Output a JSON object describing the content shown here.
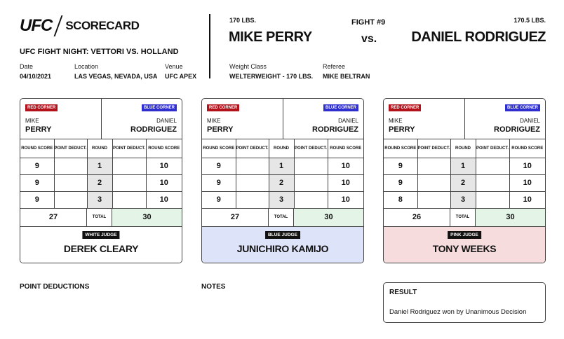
{
  "header": {
    "brand": "UFC",
    "doc_title": "SCORECARD",
    "event": "UFC FIGHT NIGHT: VETTORI VS. HOLLAND",
    "date_label": "Date",
    "date": "04/10/2021",
    "location_label": "Location",
    "location": "LAS VEGAS, NEVADA, USA",
    "venue_label": "Venue",
    "venue": "UFC APEX",
    "weight_class_label": "Weight Class",
    "weight_class": "WELTERWEIGHT - 170 LBS.",
    "referee_label": "Referee",
    "referee": "MIKE BELTRAN"
  },
  "fight": {
    "number": "FIGHT #9",
    "vs": "vs.",
    "red": {
      "weight": "170 LBS.",
      "name": "MIKE PERRY",
      "first": "MIKE",
      "last": "PERRY"
    },
    "blue": {
      "weight": "170.5 LBS.",
      "name": "DANIEL RODRIGUEZ",
      "first": "DANIEL",
      "last": "RODRIGUEZ"
    }
  },
  "labels": {
    "red_corner": "RED CORNER",
    "blue_corner": "BLUE CORNER",
    "round_score": "ROUND SCORE",
    "point_deduct": "POINT DEDUCT.",
    "round": "ROUND",
    "total": "TOTAL"
  },
  "cards": [
    {
      "judge_badge": "WHITE JUDGE",
      "judge": "DEREK CLEARY",
      "judge_bg": "#ffffff",
      "rounds": [
        {
          "red": "9",
          "red_pd": "",
          "round": "1",
          "blue_pd": "",
          "blue": "10"
        },
        {
          "red": "9",
          "red_pd": "",
          "round": "2",
          "blue_pd": "",
          "blue": "10"
        },
        {
          "red": "9",
          "red_pd": "",
          "round": "3",
          "blue_pd": "",
          "blue": "10"
        }
      ],
      "red_total": "27",
      "blue_total": "30"
    },
    {
      "judge_badge": "BLUE JUDGE",
      "judge": "JUNICHIRO KAMIJO",
      "judge_bg": "#dde3f8",
      "rounds": [
        {
          "red": "9",
          "red_pd": "",
          "round": "1",
          "blue_pd": "",
          "blue": "10"
        },
        {
          "red": "9",
          "red_pd": "",
          "round": "2",
          "blue_pd": "",
          "blue": "10"
        },
        {
          "red": "9",
          "red_pd": "",
          "round": "3",
          "blue_pd": "",
          "blue": "10"
        }
      ],
      "red_total": "27",
      "blue_total": "30"
    },
    {
      "judge_badge": "PINK JUDGE",
      "judge": "TONY WEEKS",
      "judge_bg": "#f6dcdc",
      "rounds": [
        {
          "red": "9",
          "red_pd": "",
          "round": "1",
          "blue_pd": "",
          "blue": "10"
        },
        {
          "red": "9",
          "red_pd": "",
          "round": "2",
          "blue_pd": "",
          "blue": "10"
        },
        {
          "red": "8",
          "red_pd": "",
          "round": "3",
          "blue_pd": "",
          "blue": "10"
        }
      ],
      "red_total": "26",
      "blue_total": "30"
    }
  ],
  "footer": {
    "point_deductions": "POINT DEDUCTIONS",
    "notes": "NOTES",
    "result_title": "RESULT",
    "result": "Daniel Rodriguez won by Unanimous Decision"
  }
}
